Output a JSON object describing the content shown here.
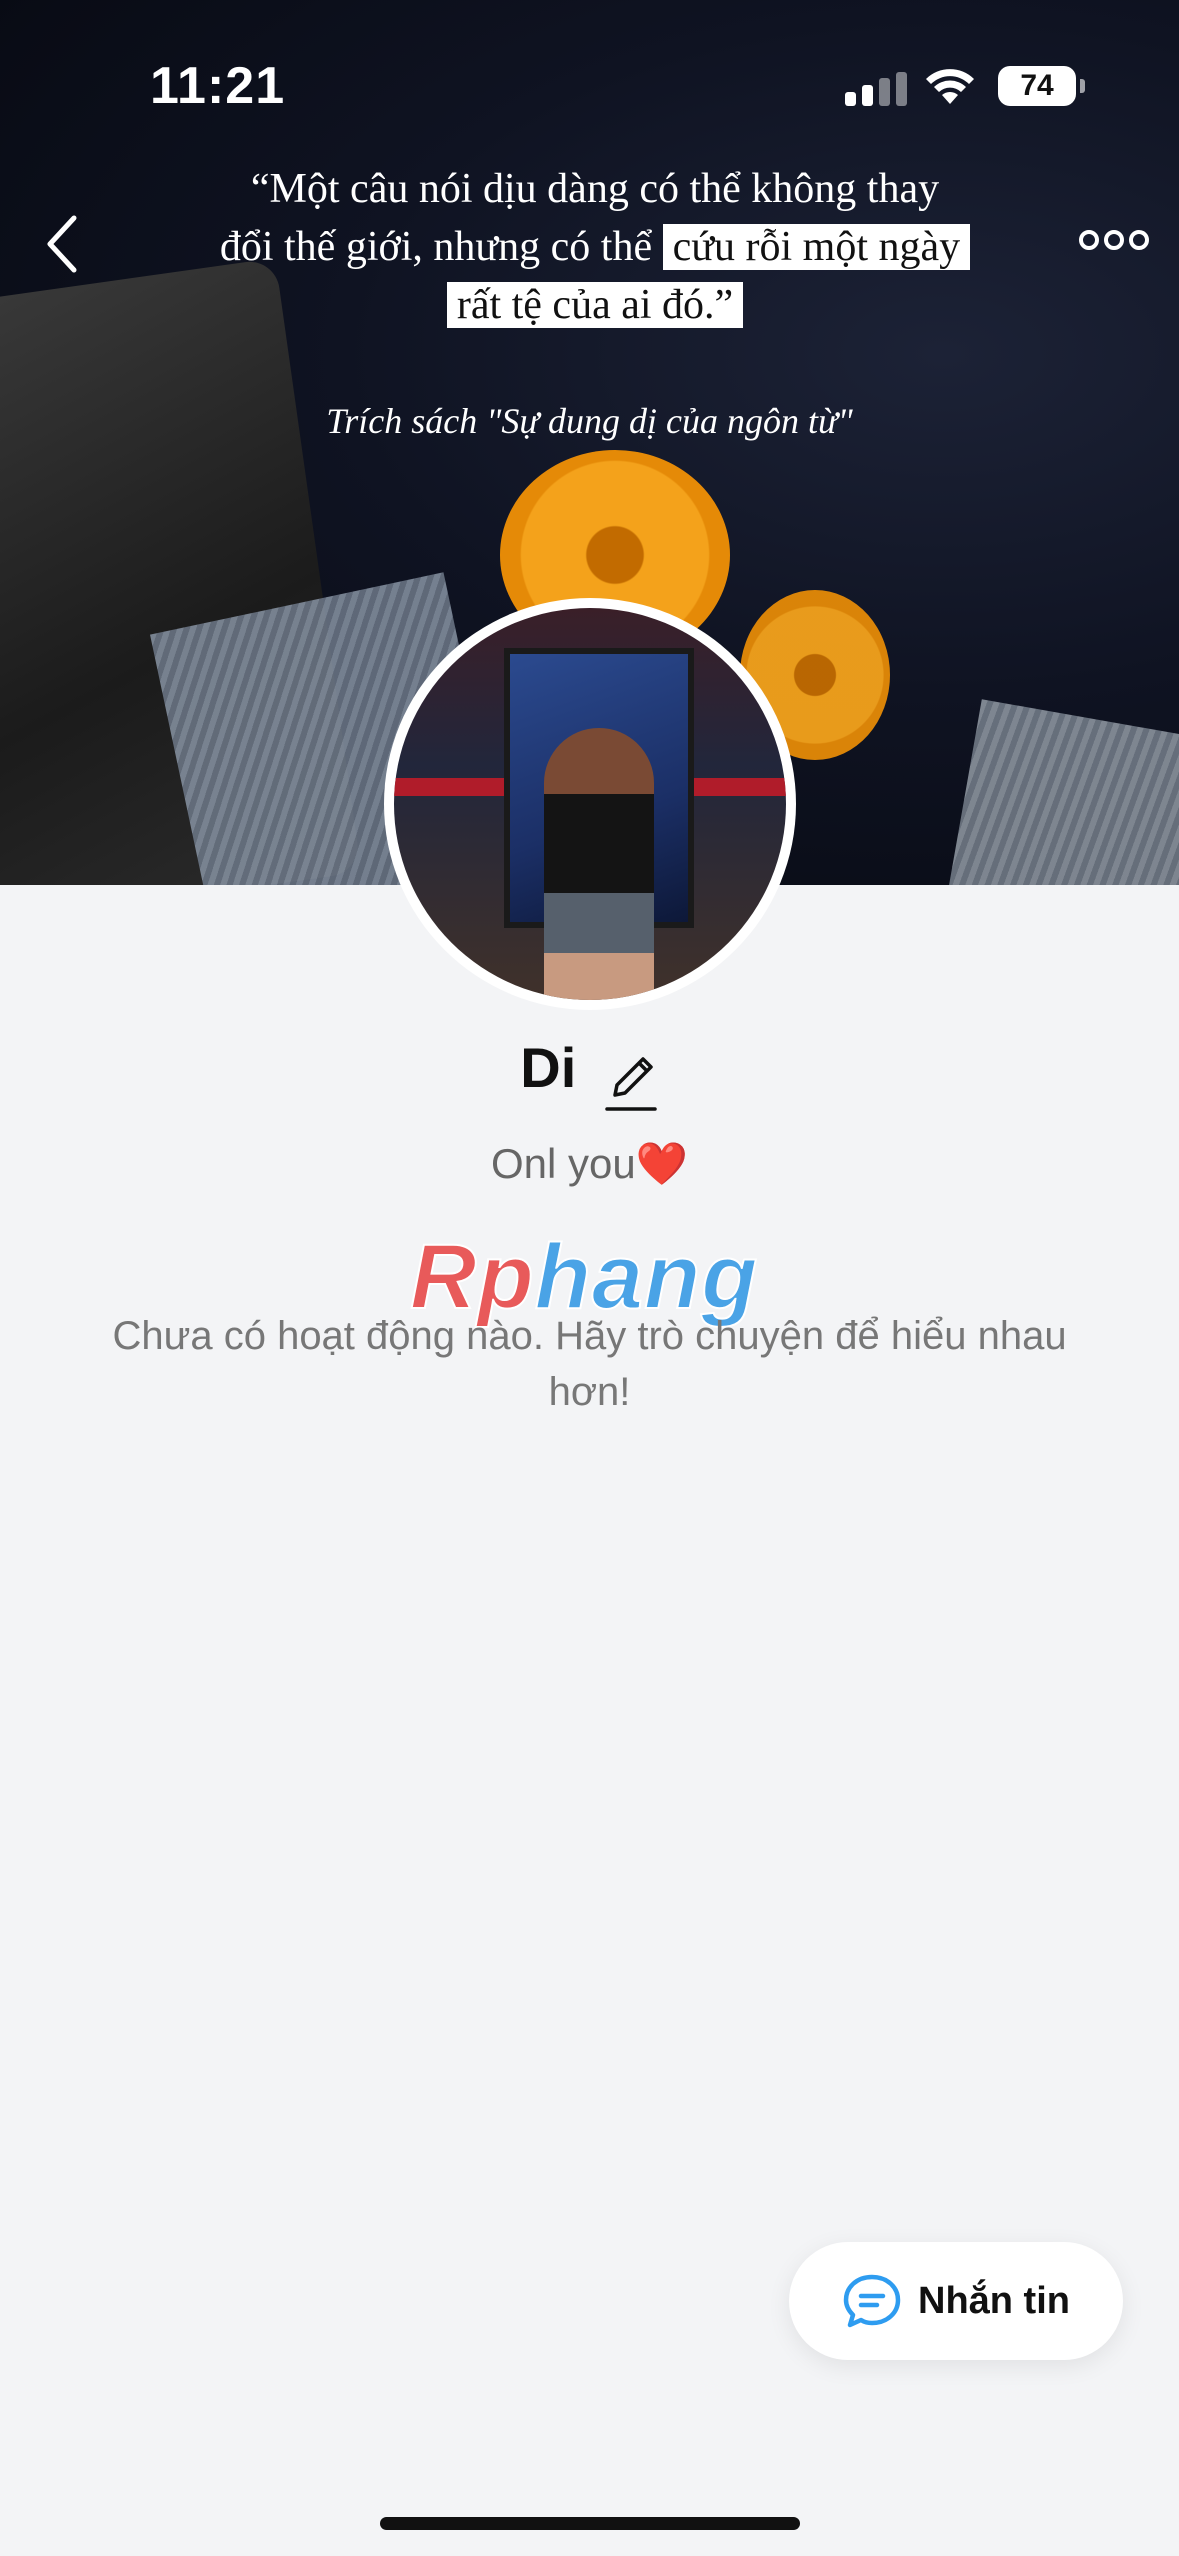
{
  "status_bar": {
    "time": "11:21",
    "battery": "74"
  },
  "cover": {
    "quote_line1": "“Một câu nói dịu dàng có thể không thay",
    "quote_line2a": "đổi thế giới, nhưng có thể",
    "quote_line2b": "cứu rỗi một ngày",
    "quote_line3": "rất tệ của ai đó.”",
    "quote_source": "Trích sách \"Sự dung dị của ngôn từ\""
  },
  "profile": {
    "name": "Di",
    "bio": "Onl you",
    "bio_emoji": "❤️",
    "empty_message": "Chưa có hoạt động nào. Hãy trò chuyện để hiểu nhau hơn!"
  },
  "watermark": {
    "part1": "Rp",
    "part2": "hang"
  },
  "actions": {
    "message_label": "Nhắn tin"
  },
  "colors": {
    "accent": "#2e9cf0",
    "heart": "#e3262f"
  }
}
